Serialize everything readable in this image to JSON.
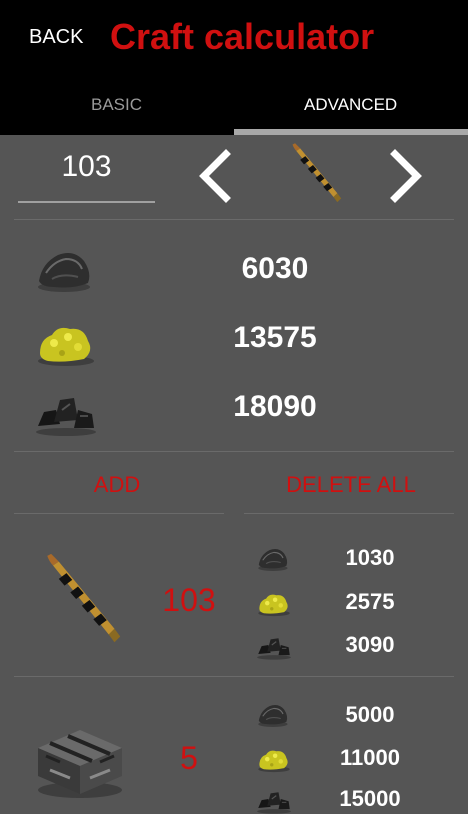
{
  "header": {
    "back_label": "BACK",
    "title": "Craft calculator"
  },
  "tabs": [
    {
      "label": "BASIC"
    },
    {
      "label": "ADVANCED"
    }
  ],
  "selector": {
    "quantity": "103",
    "item_icon": "rifle-bullet-icon"
  },
  "totals": [
    {
      "icon": "stone-icon",
      "value": "6030"
    },
    {
      "icon": "sulfur-icon",
      "value": "13575"
    },
    {
      "icon": "coal-icon",
      "value": "18090"
    }
  ],
  "actions": {
    "add_label": "ADD",
    "delete_all_label": "DELETE ALL"
  },
  "items": [
    {
      "icon": "rifle-bullet-icon",
      "qty": "103",
      "resources": [
        {
          "icon": "stone-icon",
          "value": "1030"
        },
        {
          "icon": "sulfur-icon",
          "value": "2575"
        },
        {
          "icon": "coal-icon",
          "value": "3090"
        }
      ]
    },
    {
      "icon": "explosive-crate-icon",
      "qty": "5",
      "resources": [
        {
          "icon": "stone-icon",
          "value": "5000"
        },
        {
          "icon": "sulfur-icon",
          "value": "11000"
        },
        {
          "icon": "coal-icon",
          "value": "15000"
        }
      ]
    }
  ]
}
